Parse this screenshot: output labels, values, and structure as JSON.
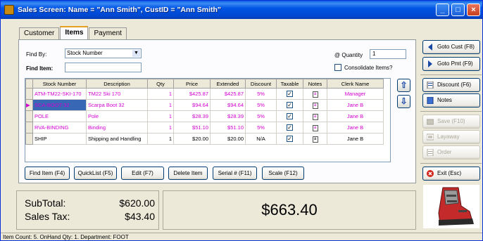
{
  "window": {
    "title": "Sales Screen: Name = \"Ann Smith\", CustID = \"Ann Smith\""
  },
  "tabs": [
    "Customer",
    "Items",
    "Payment"
  ],
  "find": {
    "label": "Find By:",
    "value": "Stock Number",
    "item_label": "Find Item:",
    "item_value": ""
  },
  "quantity": {
    "label": "@ Quantity",
    "value": "1"
  },
  "consolidate_label": "Consolidate Items?",
  "grid": {
    "columns": [
      "Stock Number",
      "Description",
      "Qty",
      "Price",
      "Extended",
      "Discount",
      "Taxable",
      "Notes",
      "Clerk Name"
    ],
    "rows": [
      {
        "stock": "ATM-TM22-SKI-170",
        "desc": "TM22 Ski 170",
        "qty": "1",
        "price": "$425.87",
        "ext": "$425.87",
        "disc": "5%",
        "taxable": true,
        "clerk": "Manager"
      },
      {
        "stock": "SCA-BOOT-32",
        "desc": "Scarpa Boot 32",
        "qty": "1",
        "price": "$94.64",
        "ext": "$94.64",
        "disc": "5%",
        "taxable": true,
        "clerk": "Jane B"
      },
      {
        "stock": "POLE",
        "desc": "Pole",
        "qty": "1",
        "price": "$28.39",
        "ext": "$28.39",
        "disc": "5%",
        "taxable": true,
        "clerk": "Jane B"
      },
      {
        "stock": "RVA-BINDING",
        "desc": "Binding",
        "qty": "1",
        "price": "$51.10",
        "ext": "$51.10",
        "disc": "5%",
        "taxable": true,
        "clerk": "Jane B"
      },
      {
        "stock": "SHIP",
        "desc": "Shipping and Handling",
        "qty": "1",
        "price": "$20.00",
        "ext": "$20.00",
        "disc": "N/A",
        "taxable": true,
        "clerk": "Jane B"
      }
    ]
  },
  "bottom_buttons": [
    "Find Item (F4)",
    "QuickList (F5)",
    "Edit (F7)",
    "Delete Item",
    "Serial # (F11)",
    "Scale (F12)"
  ],
  "right_buttons": {
    "goto_cust": "Goto Cust (F8)",
    "goto_pmt": "Goto Pmt (F9)",
    "discount": "Discount (F6)",
    "notes": "Notes",
    "save": "Save (F10)",
    "layaway": "Layaway",
    "order": "Order",
    "exit": "Exit (Esc)"
  },
  "totals": {
    "subtotal_label": "SubTotal:",
    "subtotal": "$620.00",
    "tax_label": "Sales Tax:",
    "tax": "$43.40",
    "grand_total": "$663.40"
  },
  "status_bar": "Item Count: 5. OnHand Qty: 1. Department: FOOT"
}
